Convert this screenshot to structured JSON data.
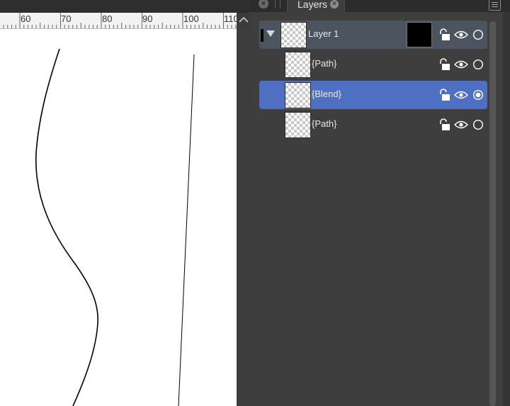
{
  "ruler": {
    "labels": [
      "60",
      "70",
      "80",
      "90",
      "100",
      "110"
    ]
  },
  "panel": {
    "tab_label": "Layers",
    "layers": [
      {
        "name": "Layer 1",
        "type": "layer",
        "expanded": true,
        "locked": false,
        "visible": true,
        "selected": false,
        "mask_color": "#000000"
      },
      {
        "name": "{Path}",
        "type": "child",
        "locked": false,
        "visible": true,
        "selected": false
      },
      {
        "name": "{Blend}",
        "type": "child",
        "locked": false,
        "visible": true,
        "selected": true
      },
      {
        "name": "{Path}",
        "type": "child",
        "locked": false,
        "visible": true,
        "selected": false
      }
    ]
  },
  "colors": {
    "selection": "#4e6fc2",
    "layer_row": "#4c5460",
    "panel_bg": "#3e3e3e",
    "canvas_bg": "#ffffff"
  },
  "icons": [
    "close-icon",
    "lock-icon",
    "eye-icon",
    "radio-icon",
    "menu-icon",
    "chevron-up-icon",
    "triangle-down-icon"
  ]
}
